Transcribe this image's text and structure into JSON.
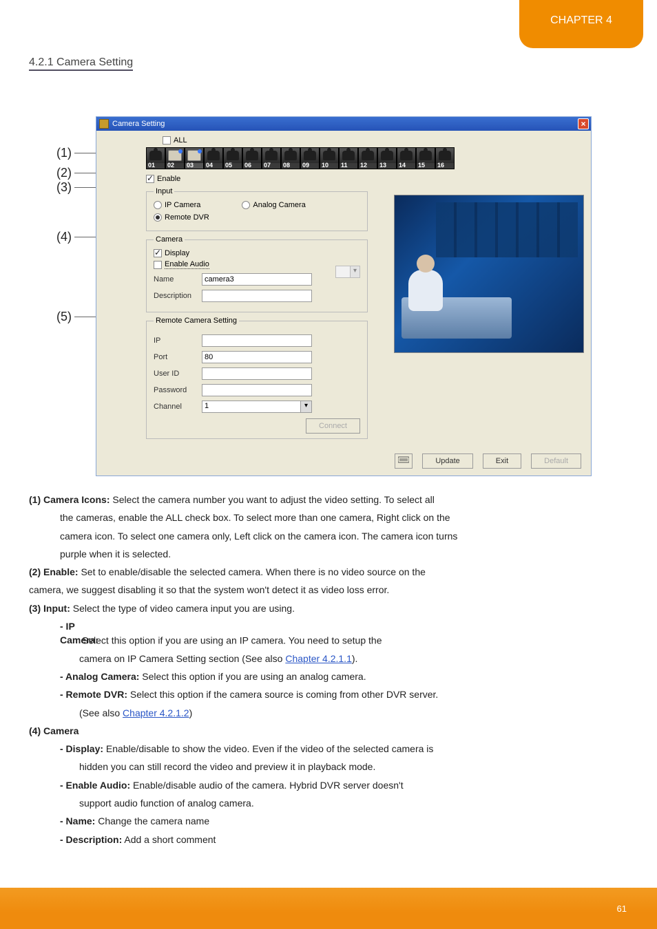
{
  "chapter_tab": "CHAPTER 4",
  "section_title": "4.2.1 Camera Setting",
  "callouts": [
    "(1)",
    "(2)",
    "(3)",
    "(4)",
    "(5)"
  ],
  "window": {
    "title": "Camera Setting",
    "all_label": "ALL",
    "cameras": [
      "01",
      "02",
      "03",
      "04",
      "05",
      "06",
      "07",
      "08",
      "09",
      "10",
      "11",
      "12",
      "13",
      "14",
      "15",
      "16"
    ],
    "enable_label": "Enable",
    "input": {
      "legend": "Input",
      "ip_camera": "IP Camera",
      "analog_camera": "Analog Camera",
      "remote_dvr": "Remote DVR"
    },
    "camera": {
      "legend": "Camera",
      "display": "Display",
      "enable_audio": "Enable Audio",
      "name_label": "Name",
      "name_value": "camera3",
      "description_label": "Description"
    },
    "remote": {
      "legend": "Remote Camera Setting",
      "ip_label": "IP",
      "port_label": "Port",
      "port_value": "80",
      "user_label": "User ID",
      "pwd_label": "Password",
      "channel_label": "Channel",
      "channel_value": "1",
      "connect": "Connect"
    },
    "footer": {
      "update": "Update",
      "exit": "Exit",
      "default": "Default"
    }
  },
  "doc": {
    "p1_lead": "(1)    Camera Icons:",
    "p1_tail": " Select the camera number you want to adjust the video setting. To select all",
    "p1b": "the cameras, enable the ALL check box. To select more than one camera, Right click on the",
    "p1c": "camera icon. To select one camera only, Left click on the camera icon. The camera icon turns",
    "p1d": "purple when it is selected.",
    "p2_lead": "(2)    Enable:",
    "p2_tail": " Set to enable/disable the selected camera. When there is no video source on the",
    "p2b": "camera, we suggest disabling it so that the system won't detect it as video loss error.",
    "p3_lead": "(3)    Input:",
    "p3_tail": " Select the type of video camera input you are using.",
    "p3_ip_lead": "- IP Camera:",
    "p3_ip_tail_a": " Select this option if you are using an IP camera. You need to setup the",
    "p3_ip_tail_b": "camera on IP Camera Setting section (See also ",
    "p3_ip_link": "Chapter 4.2.1.1",
    "p3_ip_tail_c": ").",
    "p3_an_lead": "- Analog Camera:",
    "p3_an_tail": " Select this option if you are using an analog camera.",
    "p3_rd_lead": "- Remote DVR:",
    "p3_rd_tail_a": " Select this option if the camera source is coming from other DVR server.",
    "p3_rd_tail_b": "(See also ",
    "p3_rd_link": "Chapter 4.2.1.2",
    "p3_rd_tail_c": ")",
    "p4_lead": "(4)    Camera",
    "p4_display_lead": "- Display:",
    "p4_display_tail": " Enable/disable to show the video. Even if the video of the selected camera is",
    "p4_display_b": "hidden you can still record the video and preview it in playback mode.",
    "p4_audio_lead": "- Enable Audio:",
    "p4_audio_tail": " Enable/disable audio of the camera. Hybrid DVR server doesn't",
    "p4_audio_b": "support audio function of analog camera.",
    "p4_name_lead": "- Name:",
    "p4_name_tail": " Change the camera name",
    "p4_desc_lead": "- Description:",
    "p4_desc_tail": " Add a short comment"
  },
  "page_number": "61"
}
